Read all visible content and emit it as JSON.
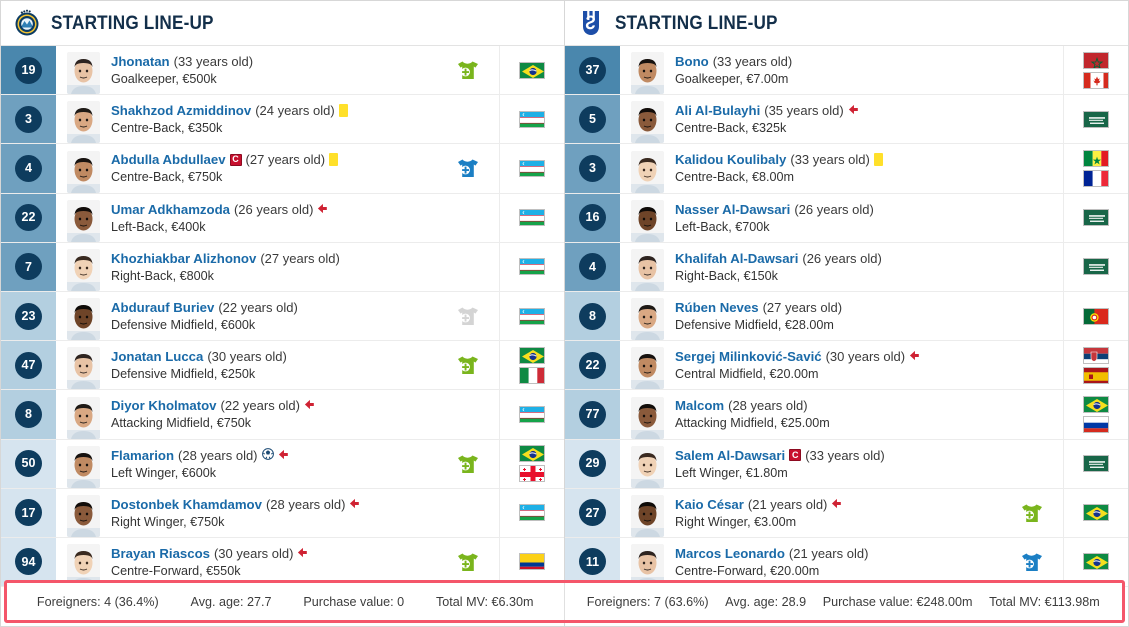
{
  "left": {
    "title": "STARTING LINE-UP",
    "crest": "club-crest-pakhtakor",
    "accent": "#0e3c5e",
    "players": [
      {
        "number": "19",
        "name": "Jhonatan",
        "age": "(33 years old)",
        "position": "Goalkeeper, €500k",
        "captain": false,
        "yellow": false,
        "goal": false,
        "arrow_out": false,
        "sub": "in",
        "flags": [
          "br"
        ],
        "shade": "#4a87ad"
      },
      {
        "number": "3",
        "name": "Shakhzod Azmiddinov",
        "age": "(24 years old)",
        "position": "Centre-Back, €350k",
        "captain": false,
        "yellow": true,
        "goal": false,
        "arrow_out": false,
        "sub": "none",
        "flags": [
          "uz"
        ],
        "shade": "#6fa0bf"
      },
      {
        "number": "4",
        "name": "Abdulla Abdullaev",
        "age": "(27 years old)",
        "position": "Centre-Back, €750k",
        "captain": true,
        "yellow": true,
        "goal": false,
        "arrow_out": false,
        "sub": "out",
        "flags": [
          "uz"
        ],
        "shade": "#6fa0bf"
      },
      {
        "number": "22",
        "name": "Umar Adkhamzoda",
        "age": "(26 years old)",
        "position": "Left-Back, €400k",
        "captain": false,
        "yellow": false,
        "goal": false,
        "arrow_out": true,
        "sub": "none",
        "flags": [
          "uz"
        ],
        "shade": "#6fa0bf"
      },
      {
        "number": "7",
        "name": "Khozhiakbar Alizhonov",
        "age": "(27 years old)",
        "position": "Right-Back, €800k",
        "captain": false,
        "yellow": false,
        "goal": false,
        "arrow_out": false,
        "sub": "none",
        "flags": [
          "uz"
        ],
        "shade": "#6fa0bf"
      },
      {
        "number": "23",
        "name": "Abdurauf Buriev",
        "age": "(22 years old)",
        "position": "Defensive Midfield, €600k",
        "captain": false,
        "yellow": false,
        "goal": false,
        "arrow_out": false,
        "sub": "grey",
        "flags": [
          "uz"
        ],
        "shade": "#b3cfe0"
      },
      {
        "number": "47",
        "name": "Jonatan Lucca",
        "age": "(30 years old)",
        "position": "Defensive Midfield, €250k",
        "captain": false,
        "yellow": false,
        "goal": false,
        "arrow_out": false,
        "sub": "in",
        "flags": [
          "br",
          "it"
        ],
        "shade": "#b3cfe0"
      },
      {
        "number": "8",
        "name": "Diyor Kholmatov",
        "age": "(22 years old)",
        "position": "Attacking Midfield, €750k",
        "captain": false,
        "yellow": false,
        "goal": false,
        "arrow_out": true,
        "sub": "none",
        "flags": [
          "uz"
        ],
        "shade": "#b3cfe0"
      },
      {
        "number": "50",
        "name": "Flamarion",
        "age": "(28 years old)",
        "position": "Left Winger, €600k",
        "captain": false,
        "yellow": false,
        "goal": true,
        "arrow_out": true,
        "sub": "in",
        "flags": [
          "br",
          "ge"
        ],
        "shade": "#d6e4ef"
      },
      {
        "number": "17",
        "name": "Dostonbek Khamdamov",
        "age": "(28 years old)",
        "position": "Right Winger, €750k",
        "captain": false,
        "yellow": false,
        "goal": false,
        "arrow_out": true,
        "sub": "none",
        "flags": [
          "uz"
        ],
        "shade": "#d6e4ef"
      },
      {
        "number": "94",
        "name": "Brayan Riascos",
        "age": "(30 years old)",
        "position": "Centre-Forward, €550k",
        "captain": false,
        "yellow": false,
        "goal": false,
        "arrow_out": true,
        "sub": "in",
        "flags": [
          "co"
        ],
        "shade": "#d6e4ef"
      }
    ],
    "summary": [
      "Foreigners: 4 (36.4%)",
      "Avg. age: 27.7",
      "Purchase value: 0",
      "Total MV: €6.30m"
    ]
  },
  "right": {
    "title": "STARTING LINE-UP",
    "crest": "club-crest-al-hilal",
    "accent": "#1d4ea8",
    "players": [
      {
        "number": "37",
        "name": "Bono",
        "age": "(33 years old)",
        "position": "Goalkeeper, €7.00m",
        "captain": false,
        "yellow": false,
        "goal": false,
        "arrow_out": false,
        "sub": "none",
        "flags": [
          "ma",
          "ca"
        ],
        "shade": "#4a87ad"
      },
      {
        "number": "5",
        "name": "Ali Al-Bulayhi",
        "age": "(35 years old)",
        "position": "Centre-Back, €325k",
        "captain": false,
        "yellow": false,
        "goal": false,
        "arrow_out": true,
        "sub": "none",
        "flags": [
          "sa"
        ],
        "shade": "#6fa0bf"
      },
      {
        "number": "3",
        "name": "Kalidou Koulibaly",
        "age": "(33 years old)",
        "position": "Centre-Back, €8.00m",
        "captain": false,
        "yellow": true,
        "goal": false,
        "arrow_out": false,
        "sub": "none",
        "flags": [
          "sn",
          "fr"
        ],
        "shade": "#6fa0bf"
      },
      {
        "number": "16",
        "name": "Nasser Al-Dawsari",
        "age": "(26 years old)",
        "position": "Left-Back, €700k",
        "captain": false,
        "yellow": false,
        "goal": false,
        "arrow_out": false,
        "sub": "none",
        "flags": [
          "sa"
        ],
        "shade": "#6fa0bf"
      },
      {
        "number": "4",
        "name": "Khalifah Al-Dawsari",
        "age": "(26 years old)",
        "position": "Right-Back, €150k",
        "captain": false,
        "yellow": false,
        "goal": false,
        "arrow_out": false,
        "sub": "none",
        "flags": [
          "sa"
        ],
        "shade": "#6fa0bf"
      },
      {
        "number": "8",
        "name": "Rúben Neves",
        "age": "(27 years old)",
        "position": "Defensive Midfield, €28.00m",
        "captain": false,
        "yellow": false,
        "goal": false,
        "arrow_out": false,
        "sub": "none",
        "flags": [
          "pt"
        ],
        "shade": "#b3cfe0"
      },
      {
        "number": "22",
        "name": "Sergej Milinković-Savić",
        "age": "(30 years old)",
        "position": "Central Midfield, €20.00m",
        "captain": false,
        "yellow": false,
        "goal": false,
        "arrow_out": true,
        "sub": "none",
        "flags": [
          "rs",
          "es"
        ],
        "shade": "#b3cfe0"
      },
      {
        "number": "77",
        "name": "Malcom",
        "age": "(28 years old)",
        "position": "Attacking Midfield, €25.00m",
        "captain": false,
        "yellow": false,
        "goal": false,
        "arrow_out": false,
        "sub": "none",
        "flags": [
          "br",
          "ru"
        ],
        "shade": "#b3cfe0"
      },
      {
        "number": "29",
        "name": "Salem Al-Dawsari",
        "age": "(33 years old)",
        "position": "Left Winger, €1.80m",
        "captain": true,
        "yellow": false,
        "goal": false,
        "arrow_out": false,
        "sub": "none",
        "flags": [
          "sa"
        ],
        "shade": "#d6e4ef"
      },
      {
        "number": "27",
        "name": "Kaio César",
        "age": "(21 years old)",
        "position": "Right Winger, €3.00m",
        "captain": false,
        "yellow": false,
        "goal": false,
        "arrow_out": true,
        "sub": "in",
        "flags": [
          "br"
        ],
        "shade": "#d6e4ef"
      },
      {
        "number": "11",
        "name": "Marcos Leonardo",
        "age": "(21 years old)",
        "position": "Centre-Forward, €20.00m",
        "captain": false,
        "yellow": false,
        "goal": false,
        "arrow_out": false,
        "sub": "out",
        "flags": [
          "br"
        ],
        "shade": "#d6e4ef"
      }
    ],
    "summary": [
      "Foreigners: 7 (63.6%)",
      "Avg. age: 28.9",
      "Purchase value: €248.00m",
      "Total MV: €113.98m"
    ]
  },
  "icons": {
    "sub_in": "substitution-in-icon",
    "sub_out": "substitution-out-icon",
    "captain": "captain-armband-icon",
    "yellow_card": "yellow-card-icon",
    "goal": "goal-ball-icon",
    "arrow_out": "substituted-off-arrow-icon"
  },
  "colors": {
    "highlight_border": "#f4566a",
    "name_link": "#1a6aa8",
    "sub_in": "#7ab51d",
    "sub_out": "#1b7fc4",
    "number_badge": "#0e3c5e"
  }
}
